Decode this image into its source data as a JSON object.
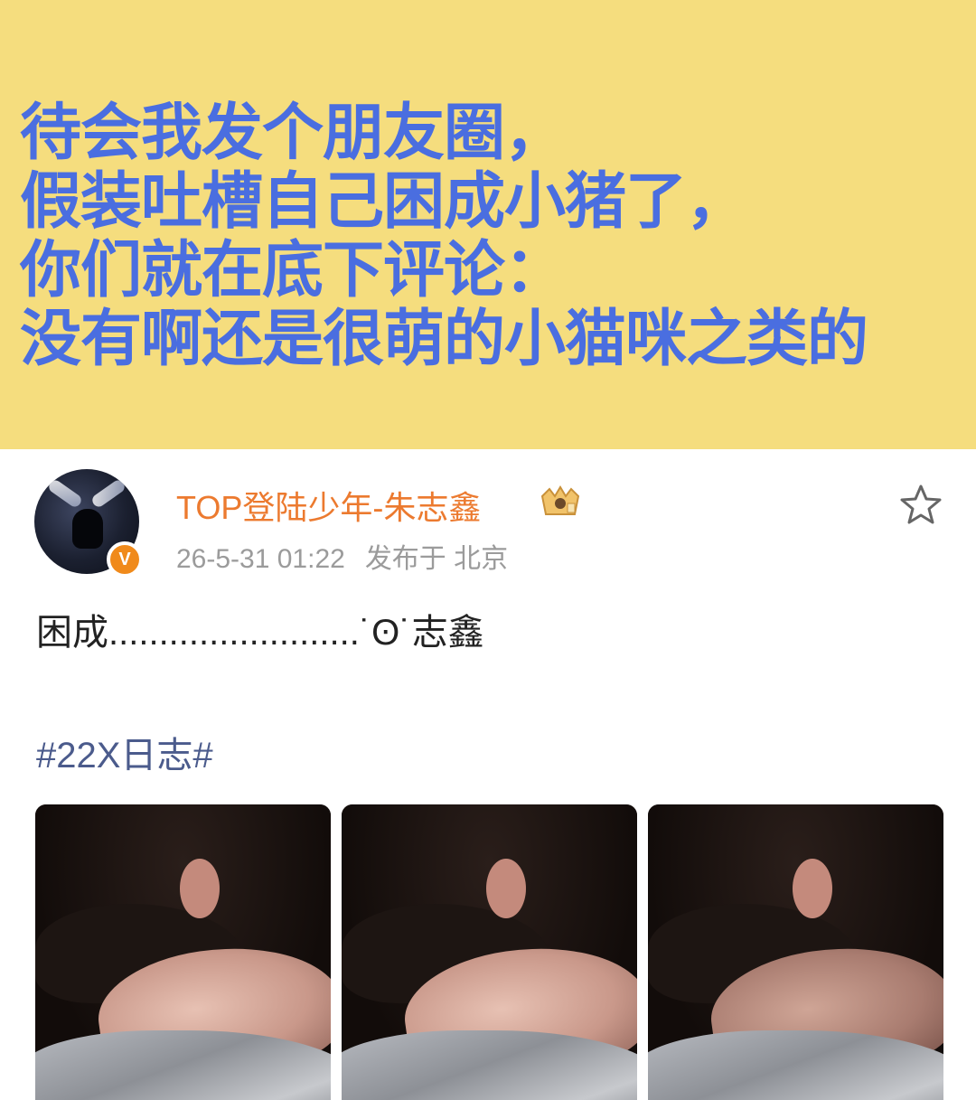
{
  "banner": {
    "text": "待会我发个朋友圈，\n假装吐槽自己困成小猪了，\n你们就在底下评论：\n没有啊还是很萌的小猫咪之类的",
    "background_color": "#f5dd7e",
    "text_color": "#4a6ee0"
  },
  "post": {
    "username": "TOP登陆少年-朱志鑫",
    "verified_badge": "V",
    "timestamp": "26-5-31 01:22",
    "location": "发布于 北京",
    "content": "困成.........................˙ʘ˙志鑫",
    "hashtag": "#22X日志#",
    "photos": [
      {
        "name": "photo-1"
      },
      {
        "name": "photo-2"
      },
      {
        "name": "photo-3"
      }
    ],
    "icons": {
      "favorite": "star-icon",
      "vip": "vip-crown-icon"
    },
    "colors": {
      "username": "#ec7a2f",
      "meta": "#9b9b9b",
      "hashtag": "#4b5b8c",
      "badge": "#f08a1b"
    }
  }
}
